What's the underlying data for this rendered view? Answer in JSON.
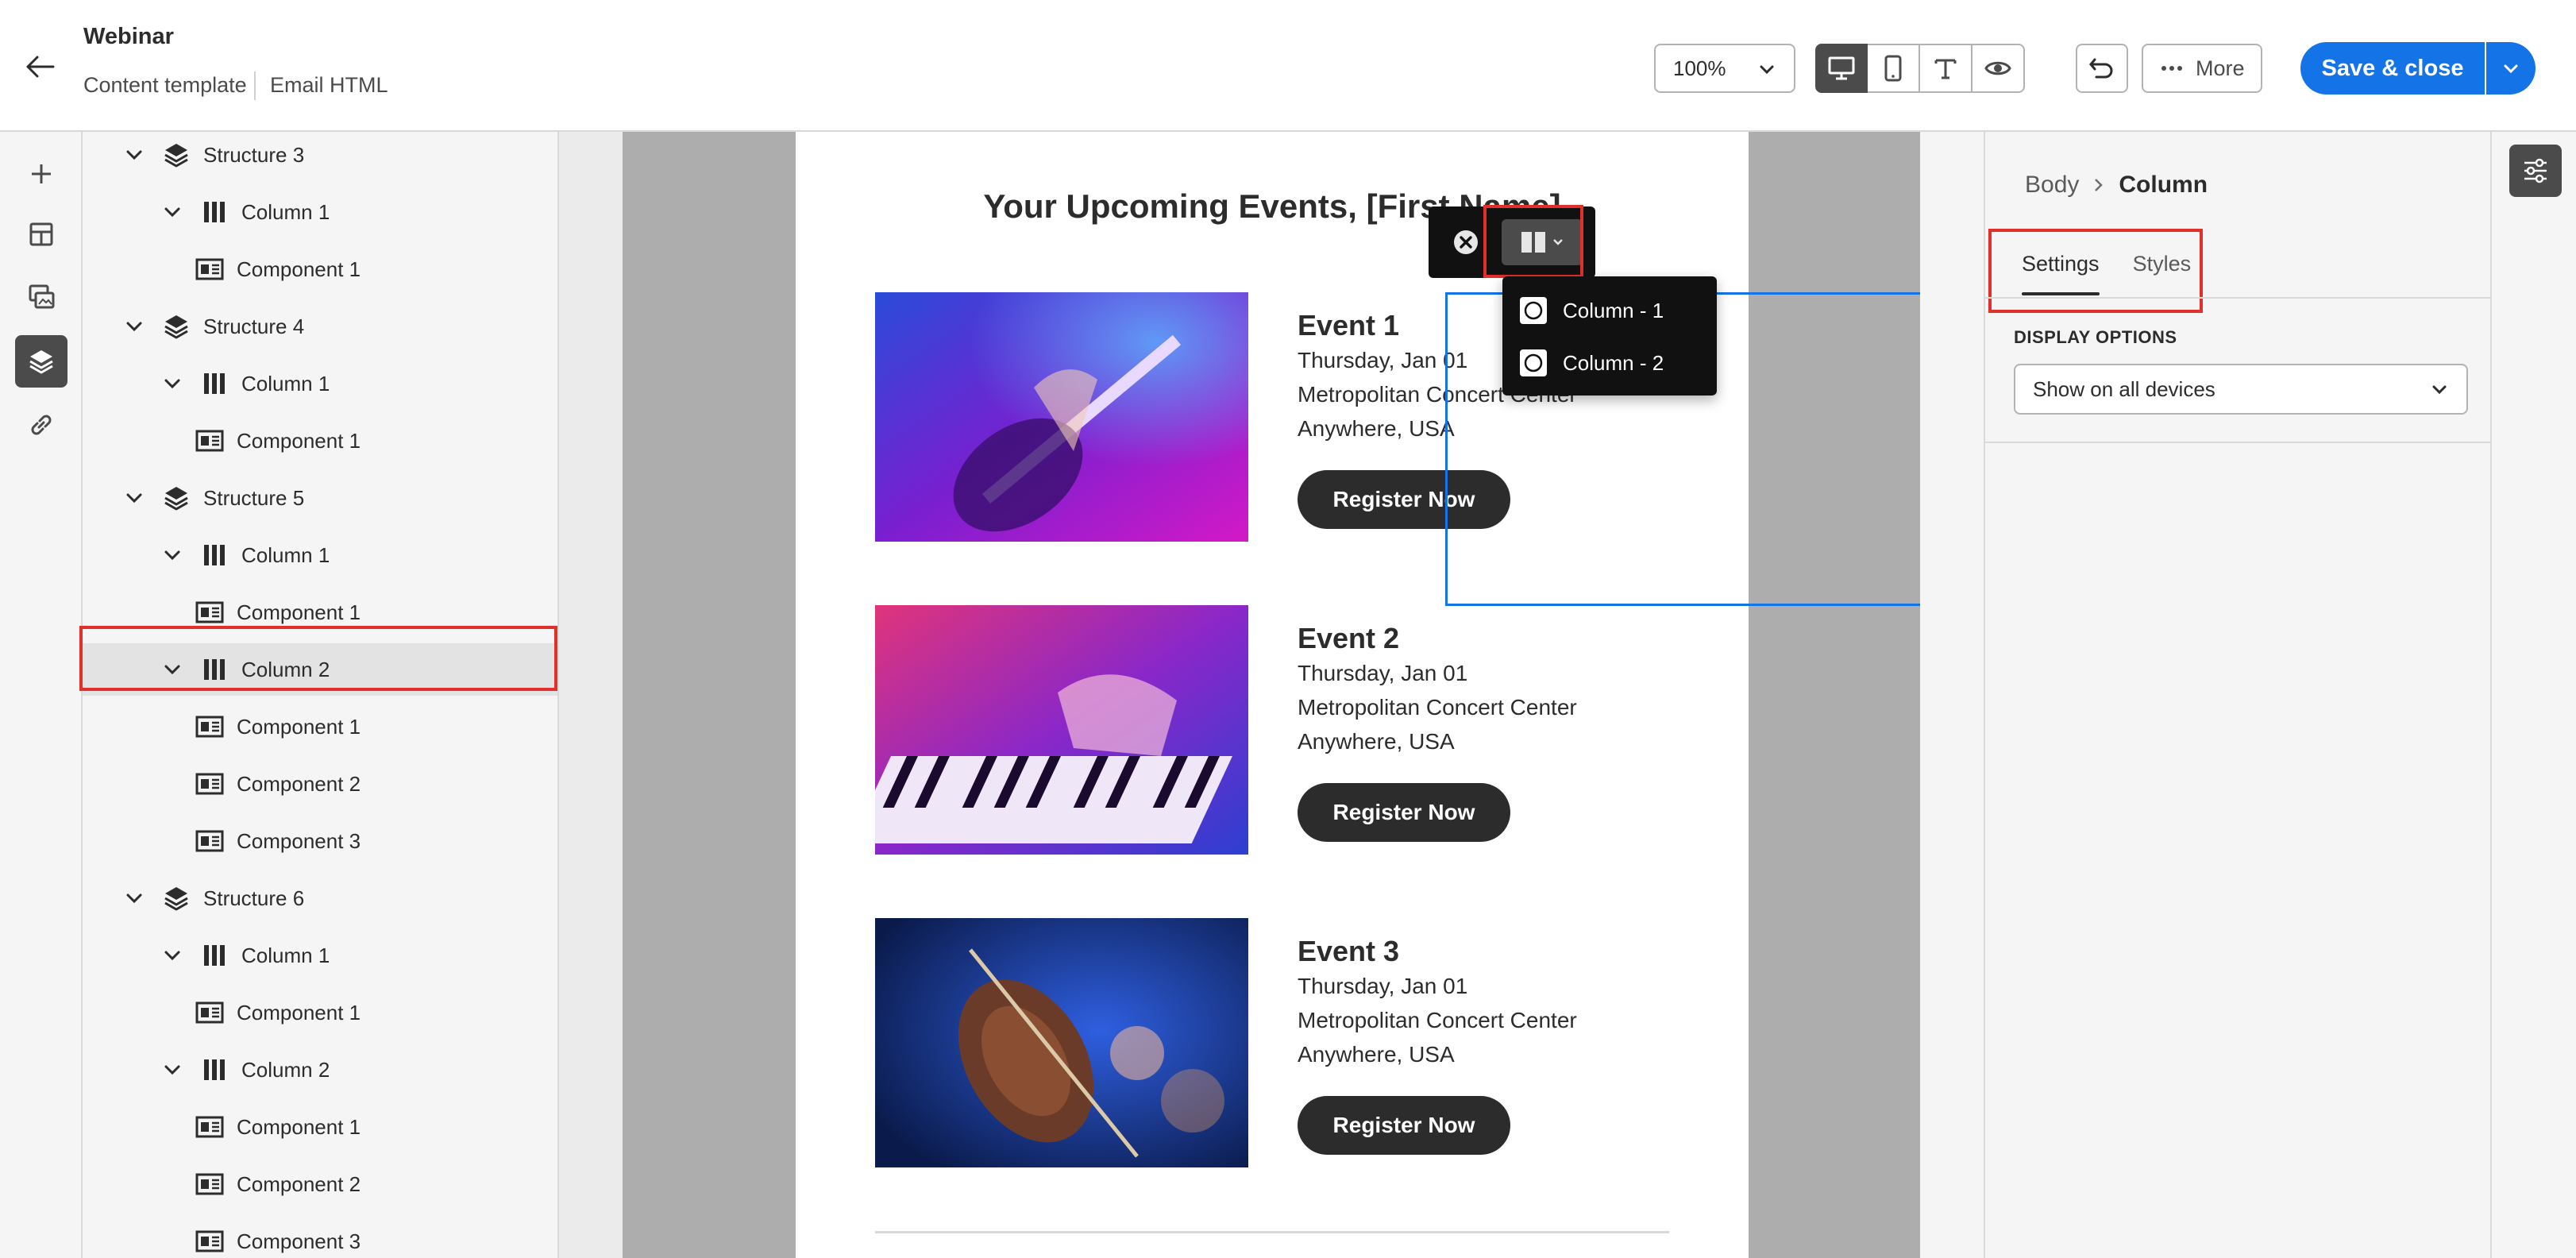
{
  "header": {
    "title": "Webinar",
    "sub_left": "Content template",
    "sub_right": "Email HTML",
    "zoom": "100%",
    "more_label": "More",
    "save_label": "Save & close"
  },
  "tree": {
    "rows": [
      {
        "label": "Structure 3",
        "type": "structure"
      },
      {
        "label": "Column 1",
        "type": "column"
      },
      {
        "label": "Component 1",
        "type": "component"
      },
      {
        "label": "Structure 4",
        "type": "structure"
      },
      {
        "label": "Column 1",
        "type": "column"
      },
      {
        "label": "Component 1",
        "type": "component"
      },
      {
        "label": "Structure 5",
        "type": "structure"
      },
      {
        "label": "Column 1",
        "type": "column"
      },
      {
        "label": "Component 1",
        "type": "component"
      },
      {
        "label": "Column 2",
        "type": "column",
        "selected": true
      },
      {
        "label": "Component 1",
        "type": "component"
      },
      {
        "label": "Component 2",
        "type": "component"
      },
      {
        "label": "Component 3",
        "type": "component"
      },
      {
        "label": "Structure 6",
        "type": "structure"
      },
      {
        "label": "Column 1",
        "type": "column"
      },
      {
        "label": "Component 1",
        "type": "component"
      },
      {
        "label": "Column 2",
        "type": "column"
      },
      {
        "label": "Component 1",
        "type": "component"
      },
      {
        "label": "Component 2",
        "type": "component"
      },
      {
        "label": "Component 3",
        "type": "component"
      }
    ]
  },
  "email": {
    "title": "Your Upcoming Events, [First Name]",
    "events": [
      {
        "name": "Event 1",
        "date": "Thursday, Jan 01",
        "venue": "Metropolitan Concert Center",
        "location": "Anywhere, USA",
        "button": "Register Now"
      },
      {
        "name": "Event 2",
        "date": "Thursday, Jan 01",
        "venue": "Metropolitan Concert Center",
        "location": "Anywhere, USA",
        "button": "Register Now"
      },
      {
        "name": "Event 3",
        "date": "Thursday, Jan 01",
        "venue": "Metropolitan Concert Center",
        "location": "Anywhere, USA",
        "button": "Register Now"
      }
    ]
  },
  "column_menu": {
    "items": [
      {
        "label": "Column - 1",
        "badge": "0"
      },
      {
        "label": "Column - 2",
        "badge": "1"
      }
    ]
  },
  "properties": {
    "breadcrumb_root": "Body",
    "breadcrumb_current": "Column",
    "tabs": [
      "Settings",
      "Styles"
    ],
    "display_label": "DISPLAY OPTIONS",
    "display_value": "Show on all devices"
  },
  "colors": {
    "accent": "#1473e6",
    "highlight": "#e0302a",
    "dark": "#2c2c2c"
  }
}
